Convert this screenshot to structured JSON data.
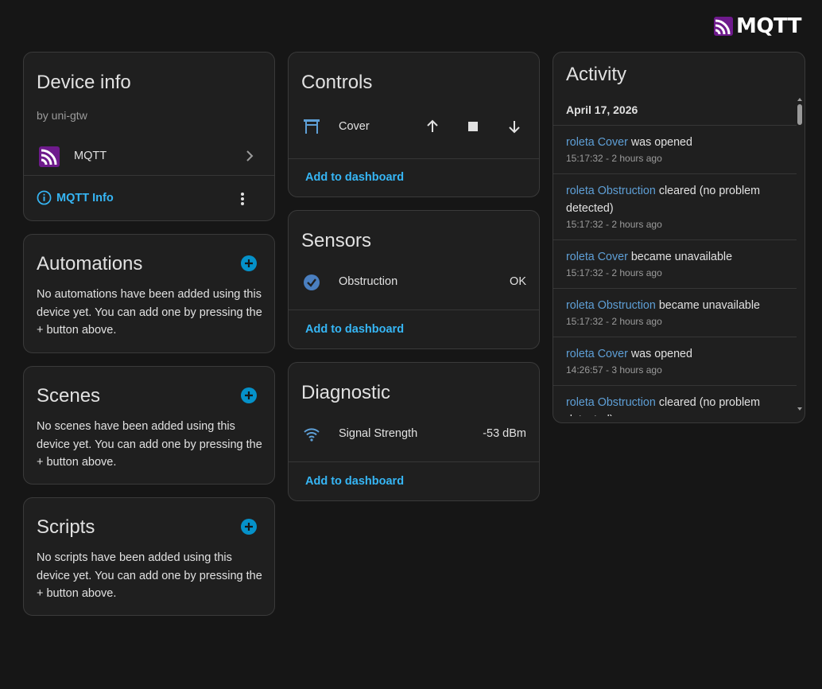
{
  "brand": {
    "logo_text": "MQTT",
    "logo_color": "#6e1a8c"
  },
  "device_info": {
    "title": "Device info",
    "by_line": "by uni-gtw",
    "integration_label": "MQTT",
    "info_link": "MQTT Info"
  },
  "automations": {
    "title": "Automations",
    "description": "No automations have been added using this device yet. You can add one by pressing the + button above."
  },
  "scenes": {
    "title": "Scenes",
    "description": "No scenes have been added using this device yet. You can add one by pressing the + button above."
  },
  "scripts": {
    "title": "Scripts",
    "description": "No scripts have been added using this device yet. You can add one by pressing the + button above."
  },
  "controls": {
    "title": "Controls",
    "entity_label": "Cover",
    "add_to_dashboard": "Add to dashboard"
  },
  "sensors": {
    "title": "Sensors",
    "entity_label": "Obstruction",
    "entity_value": "OK",
    "add_to_dashboard": "Add to dashboard"
  },
  "diagnostic": {
    "title": "Diagnostic",
    "entity_label": "Signal Strength",
    "entity_value": "-53 dBm",
    "add_to_dashboard": "Add to dashboard"
  },
  "activity": {
    "title": "Activity",
    "date": "April 17, 2026",
    "entries": [
      {
        "entity": "roleta Cover",
        "action": "was opened",
        "time": "15:17:32 - 2 hours ago"
      },
      {
        "entity": "roleta Obstruction",
        "action": "cleared (no problem detected)",
        "time": "15:17:32 - 2 hours ago"
      },
      {
        "entity": "roleta Cover",
        "action": "became unavailable",
        "time": "15:17:32 - 2 hours ago"
      },
      {
        "entity": "roleta Obstruction",
        "action": "became unavailable",
        "time": "15:17:32 - 2 hours ago"
      },
      {
        "entity": "roleta Cover",
        "action": "was opened",
        "time": "14:26:57 - 3 hours ago"
      },
      {
        "entity": "roleta Obstruction",
        "action": "cleared (no problem detected)",
        "time": ""
      }
    ]
  }
}
